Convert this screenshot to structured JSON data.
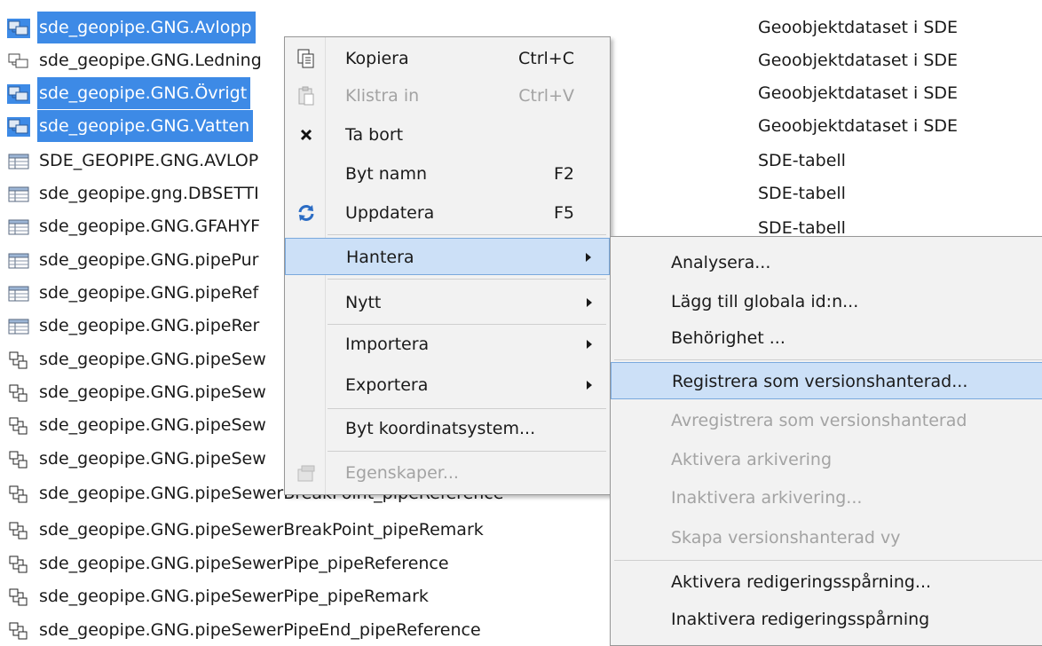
{
  "tree": {
    "items": [
      {
        "name": "sde_geopipe.GNG.Avlopp",
        "icon": "feature-dataset-icon",
        "selected": true
      },
      {
        "name": "sde_geopipe.GNG.Ledning",
        "icon": "feature-dataset-icon",
        "selected": false
      },
      {
        "name": "sde_geopipe.GNG.Övrigt",
        "icon": "feature-dataset-icon",
        "selected": true
      },
      {
        "name": "sde_geopipe.GNG.Vatten",
        "icon": "feature-dataset-icon",
        "selected": true
      },
      {
        "name": "SDE_GEOPIPE.GNG.AVLOP",
        "icon": "table-icon",
        "selected": false
      },
      {
        "name": "sde_geopipe.gng.DBSETTI",
        "icon": "table-icon",
        "selected": false
      },
      {
        "name": "sde_geopipe.GNG.GFAHYF",
        "icon": "table-icon",
        "selected": false
      },
      {
        "name": "sde_geopipe.GNG.pipePur",
        "icon": "table-icon",
        "selected": false
      },
      {
        "name": "sde_geopipe.GNG.pipeRef",
        "icon": "table-icon",
        "selected": false
      },
      {
        "name": "sde_geopipe.GNG.pipeRer",
        "icon": "table-icon",
        "selected": false
      },
      {
        "name": "sde_geopipe.GNG.pipeSew",
        "icon": "relationship-class-icon",
        "selected": false
      },
      {
        "name": "sde_geopipe.GNG.pipeSew",
        "icon": "relationship-class-icon",
        "selected": false
      },
      {
        "name": "sde_geopipe.GNG.pipeSew",
        "icon": "relationship-class-icon",
        "selected": false
      },
      {
        "name": "sde_geopipe.GNG.pipeSew",
        "icon": "relationship-class-icon",
        "selected": false
      },
      {
        "name": "sde_geopipe.GNG.pipeSewerBreakPoint_pipeReference",
        "icon": "relationship-class-icon",
        "selected": false
      },
      {
        "name": "sde_geopipe.GNG.pipeSewerBreakPoint_pipeRemark",
        "icon": "relationship-class-icon",
        "selected": false
      },
      {
        "name": "sde_geopipe.GNG.pipeSewerPipe_pipeReference",
        "icon": "relationship-class-icon",
        "selected": false
      },
      {
        "name": "sde_geopipe.GNG.pipeSewerPipe_pipeRemark",
        "icon": "relationship-class-icon",
        "selected": false
      },
      {
        "name": "sde_geopipe.GNG.pipeSewerPipeEnd_pipeReference",
        "icon": "relationship-class-icon",
        "selected": false
      }
    ],
    "types": [
      "Geoobjektdataset i SDE",
      "Geoobjektdataset i SDE",
      "Geoobjektdataset i SDE",
      "Geoobjektdataset i SDE",
      "SDE-tabell",
      "SDE-tabell",
      "SDE-tabell"
    ]
  },
  "context_menu": {
    "items": [
      {
        "label": "Kopiera",
        "shortcut": "Ctrl+C",
        "icon": "copy-icon",
        "disabled": false
      },
      {
        "label": "Klistra in",
        "shortcut": "Ctrl+V",
        "icon": "paste-icon",
        "disabled": true
      },
      {
        "label": "Ta bort",
        "shortcut": "",
        "icon": "delete-icon",
        "disabled": false
      },
      {
        "label": "Byt namn",
        "shortcut": "F2",
        "icon": "",
        "disabled": false
      },
      {
        "label": "Uppdatera",
        "shortcut": "F5",
        "icon": "refresh-icon",
        "disabled": false
      },
      {
        "label": "Hantera",
        "submenu": true,
        "highlighted": true
      },
      {
        "label": "Nytt",
        "submenu": true
      },
      {
        "label": "Importera",
        "submenu": true
      },
      {
        "label": "Exportera",
        "submenu": true
      },
      {
        "label": "Byt koordinatsystem..."
      },
      {
        "label": "Egenskaper...",
        "icon": "properties-icon",
        "disabled": true
      }
    ]
  },
  "submenu": {
    "items": [
      {
        "label": "Analysera...",
        "disabled": false
      },
      {
        "label": "Lägg till globala id:n...",
        "disabled": false
      },
      {
        "label": "Behörighet ...",
        "disabled": false
      },
      {
        "label": "Registrera som versionshanterad...",
        "disabled": false,
        "highlighted": true
      },
      {
        "label": "Avregistrera som versionshanterad",
        "disabled": true
      },
      {
        "label": "Aktivera arkivering",
        "disabled": true
      },
      {
        "label": "Inaktivera arkivering...",
        "disabled": true
      },
      {
        "label": "Skapa versionshanterad vy",
        "disabled": true
      },
      {
        "label": "Aktivera redigeringsspårning...",
        "disabled": false
      },
      {
        "label": "Inaktivera redigeringsspårning",
        "disabled": false
      }
    ]
  }
}
